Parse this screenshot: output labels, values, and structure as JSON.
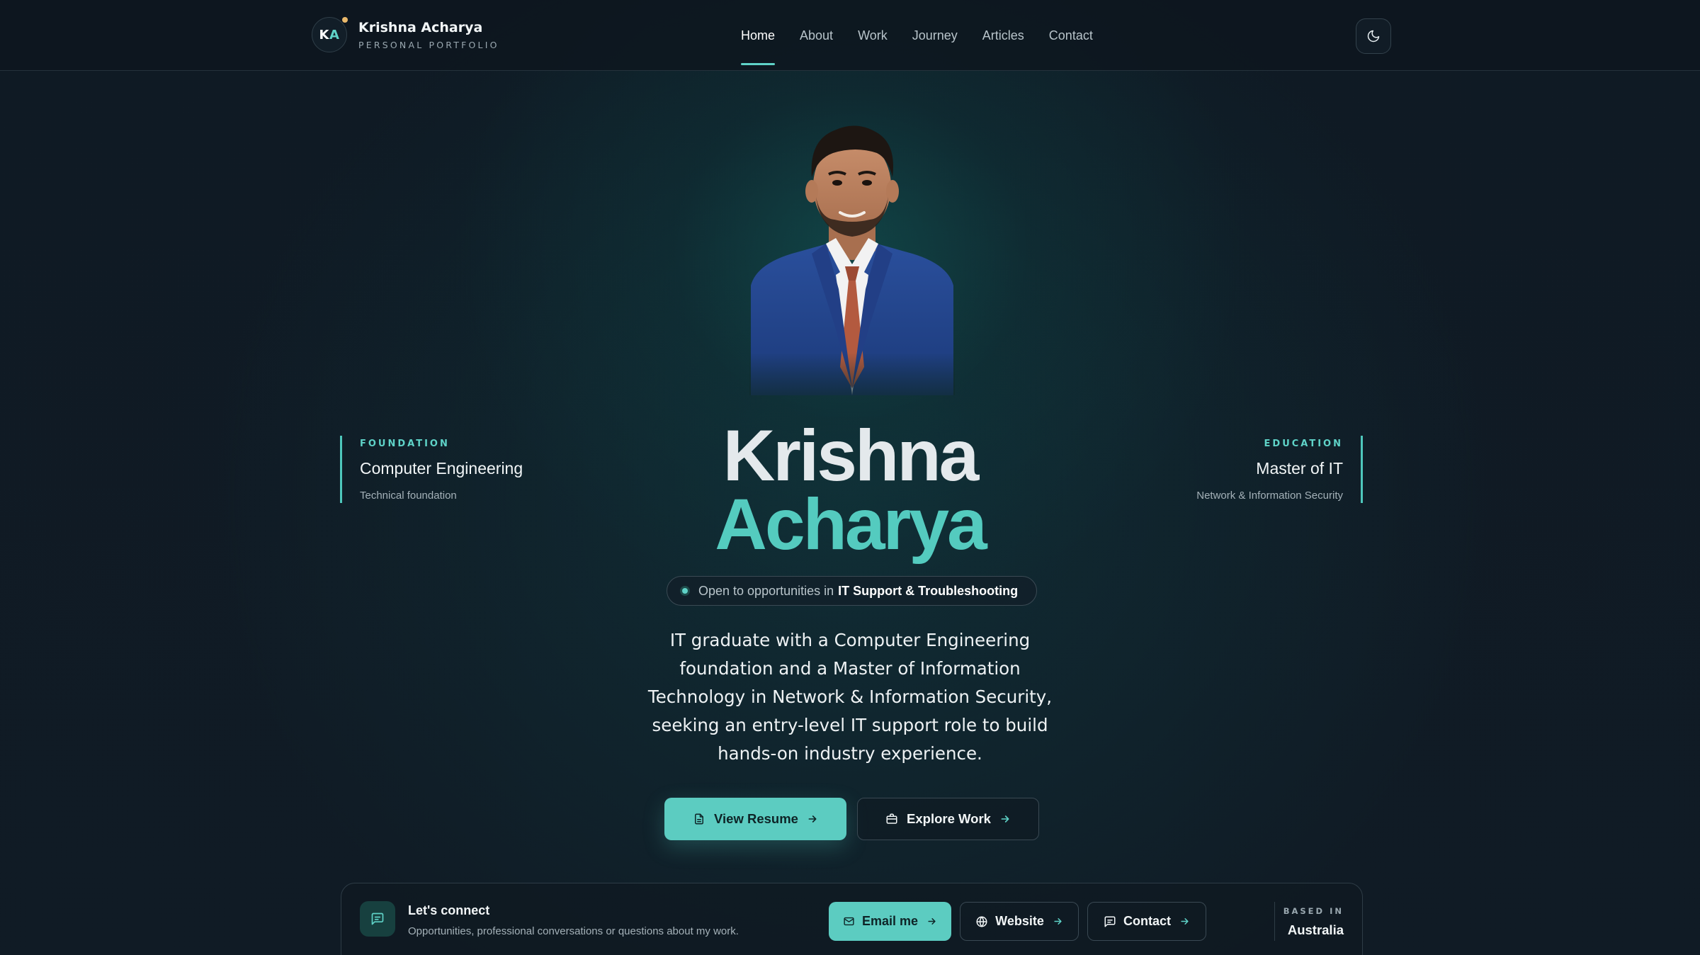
{
  "brand": {
    "initials_first": "K",
    "initials_second": "A",
    "name": "Krishna Acharya",
    "subtitle": "PERSONAL PORTFOLIO"
  },
  "nav": {
    "items": [
      {
        "label": "Home",
        "active": true
      },
      {
        "label": "About",
        "active": false
      },
      {
        "label": "Work",
        "active": false
      },
      {
        "label": "Journey",
        "active": false
      },
      {
        "label": "Articles",
        "active": false
      },
      {
        "label": "Contact",
        "active": false
      }
    ],
    "theme_toggle_icon": "moon-icon"
  },
  "hero": {
    "first_name": "Krishna",
    "last_name": "Acharya",
    "status_prefix": "Open to opportunities in",
    "status_role": "IT Support & Troubleshooting",
    "bio": "IT graduate with a Computer Engineering foundation and a Master of Information Technology in Network & Information Security, seeking an entry-level IT support role to build hands-on industry experience.",
    "primary_cta": "View Resume",
    "secondary_cta": "Explore Work"
  },
  "left_card": {
    "eyebrow": "FOUNDATION",
    "title": "Computer Engineering",
    "subtitle": "Technical foundation"
  },
  "right_card": {
    "eyebrow": "EDUCATION",
    "title": "Master of IT",
    "subtitle": "Network & Information Security"
  },
  "connect": {
    "title": "Let's connect",
    "subtitle": "Opportunities, professional conversations or questions about my work.",
    "email_label": "Email me",
    "website_label": "Website",
    "contact_label": "Contact",
    "based_label": "BASED IN",
    "based_value": "Australia"
  },
  "colors": {
    "accent": "#5cccc1",
    "background": "#0f1a24",
    "brand_dot": "#e9b86b"
  }
}
